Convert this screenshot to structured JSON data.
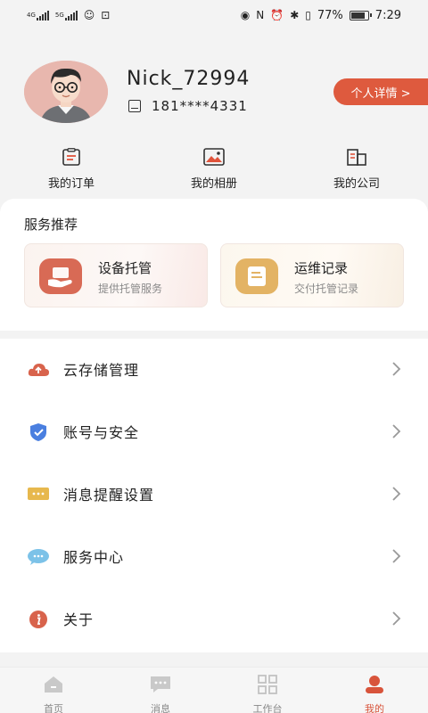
{
  "status_bar": {
    "network_top": "4G",
    "network_bottom": "5G",
    "battery": "77%",
    "time": "7:29"
  },
  "profile": {
    "username": "Nick_72994",
    "phone": "181****4331",
    "detail_button": "个人详情 >"
  },
  "quick_links": [
    {
      "label": "我的订单",
      "icon": "order-icon"
    },
    {
      "label": "我的相册",
      "icon": "album-icon"
    },
    {
      "label": "我的公司",
      "icon": "company-icon"
    }
  ],
  "service": {
    "title": "服务推荐",
    "cards": [
      {
        "name": "设备托管",
        "sub": "提供托管服务",
        "icon": "device-hosting-icon",
        "color": "#d86a55"
      },
      {
        "name": "运维记录",
        "sub": "交付托管记录",
        "icon": "maintenance-record-icon",
        "color": "#e3b364"
      }
    ]
  },
  "menu": [
    {
      "label": "云存储管理",
      "icon": "cloud-upload-icon"
    },
    {
      "label": "账号与安全",
      "icon": "shield-icon"
    },
    {
      "label": "消息提醒设置",
      "icon": "message-icon"
    },
    {
      "label": "服务中心",
      "icon": "chat-bubble-icon"
    },
    {
      "label": "关于",
      "icon": "info-icon"
    }
  ],
  "tabs": [
    {
      "label": "首页",
      "icon": "home-icon",
      "active": false
    },
    {
      "label": "消息",
      "icon": "message-tab-icon",
      "active": false
    },
    {
      "label": "工作台",
      "icon": "grid-icon",
      "active": false
    },
    {
      "label": "我的",
      "icon": "person-icon",
      "active": true
    }
  ],
  "colors": {
    "accent": "#de5a3e",
    "active_tab": "#d8543b"
  }
}
